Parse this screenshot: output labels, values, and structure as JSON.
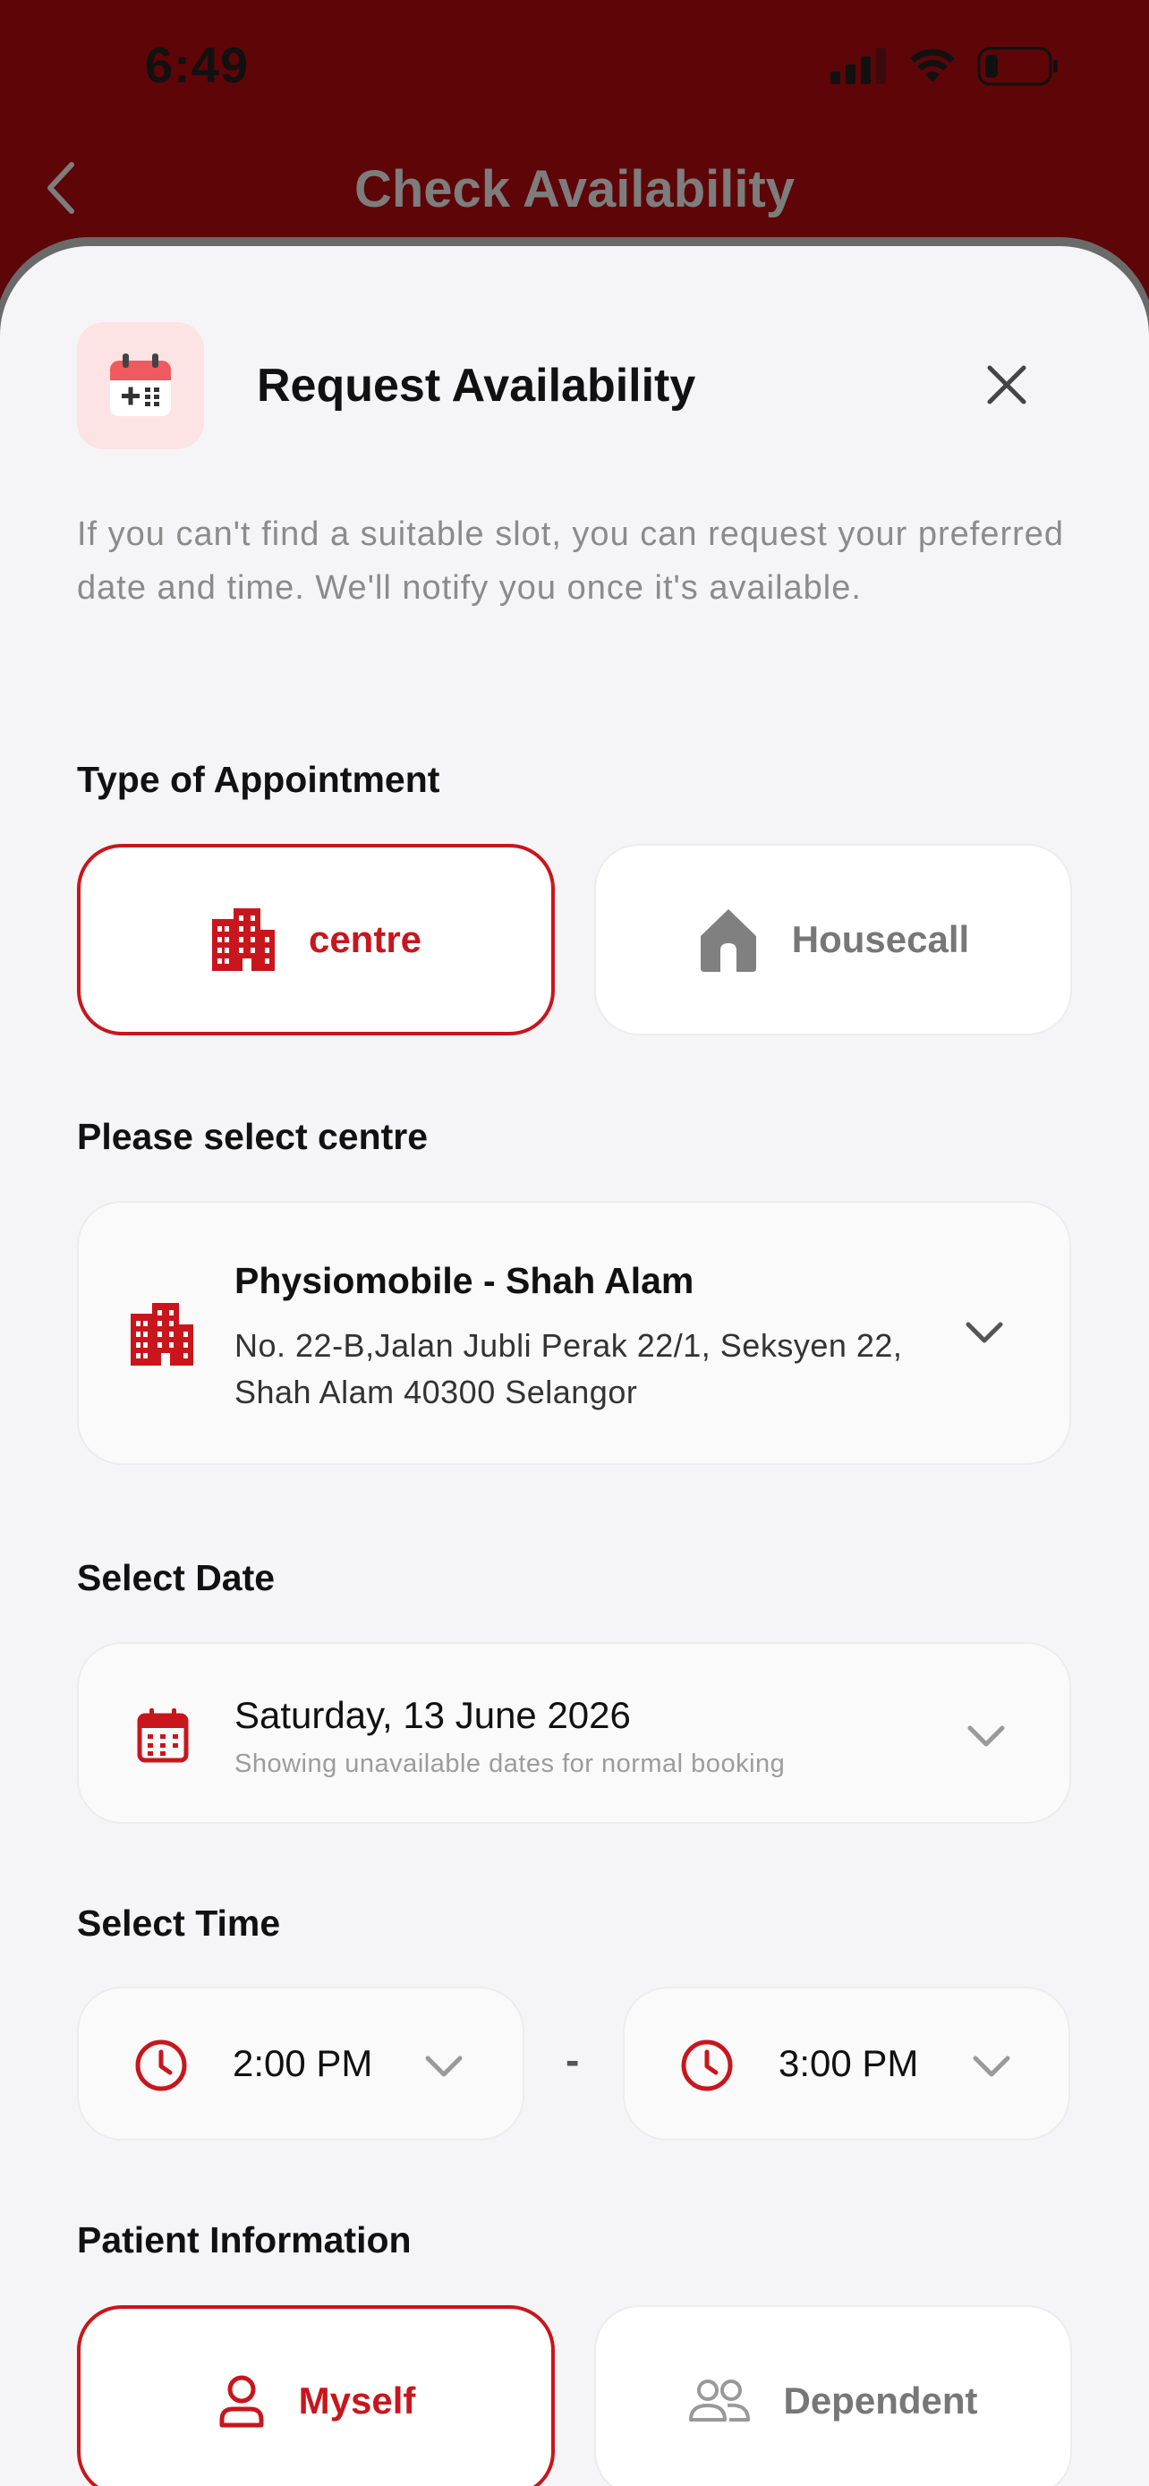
{
  "status_bar": {
    "time": "6:49"
  },
  "nav": {
    "title": "Check Availability"
  },
  "sheet": {
    "title": "Request Availability",
    "description": "If you can't find a suitable slot, you can request your preferred date and time. We'll notify you once it's available."
  },
  "appointment_type": {
    "label": "Type of Appointment",
    "options": [
      {
        "label": "centre",
        "icon": "building-icon",
        "selected": true
      },
      {
        "label": "Housecall",
        "icon": "house-icon",
        "selected": false
      }
    ]
  },
  "centre": {
    "label": "Please select centre",
    "name": "Physiomobile - Shah Alam",
    "address": "No. 22-B,Jalan Jubli Perak 22/1, Seksyen 22, Shah Alam 40300 Selangor"
  },
  "date": {
    "label": "Select Date",
    "value": "Saturday, 13 June 2026",
    "hint": "Showing unavailable dates for normal booking"
  },
  "time": {
    "label": "Select Time",
    "start": "2:00 PM",
    "separator": "-",
    "end": "3:00 PM"
  },
  "patient": {
    "label": "Patient Information",
    "options": [
      {
        "label": "Myself",
        "icon": "person-icon",
        "selected": true
      },
      {
        "label": "Dependent",
        "icon": "people-icon",
        "selected": false
      }
    ]
  },
  "colors": {
    "brand_red": "#c8161c",
    "header_bg": "#5e0508",
    "sheet_bg": "#f5f5f7"
  }
}
